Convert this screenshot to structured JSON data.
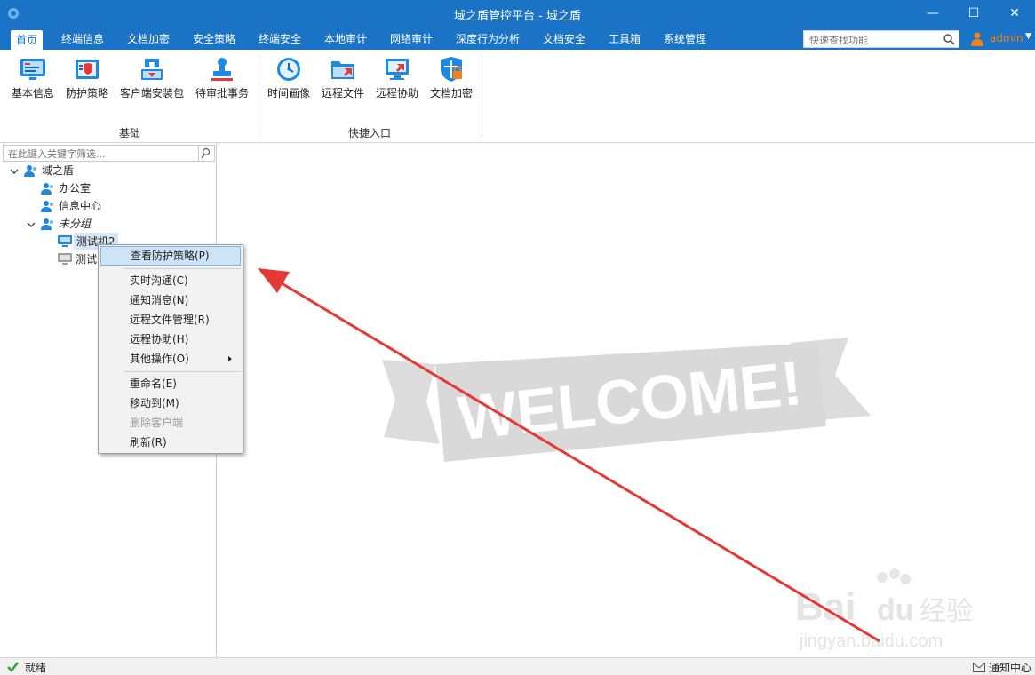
{
  "window": {
    "title": "域之盾管控平台 - 域之盾",
    "minimize": "—",
    "maximize": "☐",
    "close": "✕"
  },
  "menu": {
    "tabs": [
      "首页",
      "终端信息",
      "文档加密",
      "安全策略",
      "终端安全",
      "本地审计",
      "网络审计",
      "深度行为分析",
      "文档安全",
      "工具箱",
      "系统管理"
    ],
    "search_placeholder": "快速查找功能",
    "user": "admin"
  },
  "ribbon": {
    "group1": {
      "label": "基础",
      "buttons": [
        "基本信息",
        "防护策略",
        "客户端安装包",
        "待审批事务"
      ]
    },
    "group2": {
      "label": "快捷入口",
      "buttons": [
        "时间画像",
        "远程文件",
        "远程协助",
        "文档加密"
      ]
    }
  },
  "tree": {
    "filter_placeholder": "在此键入关键字筛选...",
    "root": "域之盾",
    "children": [
      "办公室",
      "信息中心",
      "未分组"
    ],
    "ungrouped_children": [
      "测试机2",
      "测试"
    ]
  },
  "context_menu": {
    "items": [
      {
        "label": "查看防护策略(P)",
        "state": "highlighted"
      },
      {
        "label": "实时沟通(C)"
      },
      {
        "label": "通知消息(N)"
      },
      {
        "label": "远程文件管理(R)"
      },
      {
        "label": "远程协助(H)"
      },
      {
        "label": "其他操作(O)",
        "submenu": true
      },
      {
        "label": "重命名(E)"
      },
      {
        "label": "移动到(M)"
      },
      {
        "label": "删除客户端",
        "state": "disabled"
      },
      {
        "label": "刷新(R)"
      }
    ]
  },
  "content": {
    "banner": "WELCOME!"
  },
  "status": {
    "left": "就绪",
    "right": "通知中心"
  },
  "watermark": {
    "line1": "Bai",
    "line2": "du",
    "line3": "经验",
    "url": "jingyan.baidu.com"
  },
  "colors": {
    "accent": "#1a73c4",
    "user": "#f08020",
    "arrow": "#e53935",
    "banner": "#d9d9d9"
  }
}
